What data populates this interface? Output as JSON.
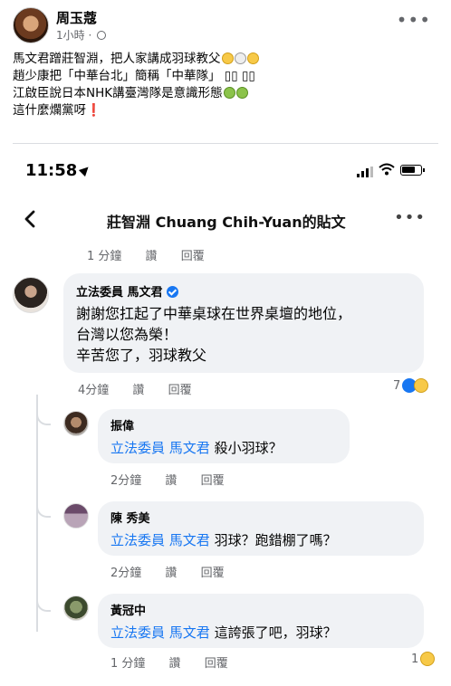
{
  "post": {
    "author": "周玉蔻",
    "meta": "1小時 ·",
    "more": "•••",
    "lines": [
      "馬文君蹭莊智淵，把人家講成羽球教父",
      "趙少康把「中華台北」簡稱「中華隊」",
      "江啟臣說日本NHK講臺灣隊是意識形態",
      "這什麼爛黨呀"
    ],
    "line2_suffix": "▯▯ ▯▯",
    "excl": "❗"
  },
  "screenshot": {
    "time": "11:58",
    "battery_level": 0.75,
    "nav_title": "莊智淵 Chuang Chih-Yuan的貼文",
    "nav_more": "•••",
    "top_actions": {
      "time": "1 分鐘",
      "like": "讚",
      "reply": "回覆"
    },
    "comments": [
      {
        "name": "立法委員 馬文君",
        "lines": [
          "謝謝您扛起了中華桌球在世界桌壇的地位，",
          "台灣以您為榮！",
          "辛苦您了，羽球教父"
        ],
        "time": "4分鐘",
        "like": "讚",
        "reply": "回覆",
        "reaction_count": "7"
      }
    ],
    "replies": [
      {
        "name": "振偉",
        "tag": "立法委員 馬文君",
        "text": "殺小羽球？",
        "time": "2分鐘",
        "like": "讚",
        "reply": "回覆"
      },
      {
        "name": "陳 秀美",
        "tag": "立法委員 馬文君",
        "text": "羽球？跑錯棚了嗎？",
        "time": "2分鐘",
        "like": "讚",
        "reply": "回覆"
      },
      {
        "name": "黃冠中",
        "tag": "立法委員 馬文君",
        "text": "這誇張了吧，羽球？",
        "time": "1 分鐘",
        "like": "讚",
        "reply": "回覆",
        "reaction_count": "1"
      }
    ]
  }
}
